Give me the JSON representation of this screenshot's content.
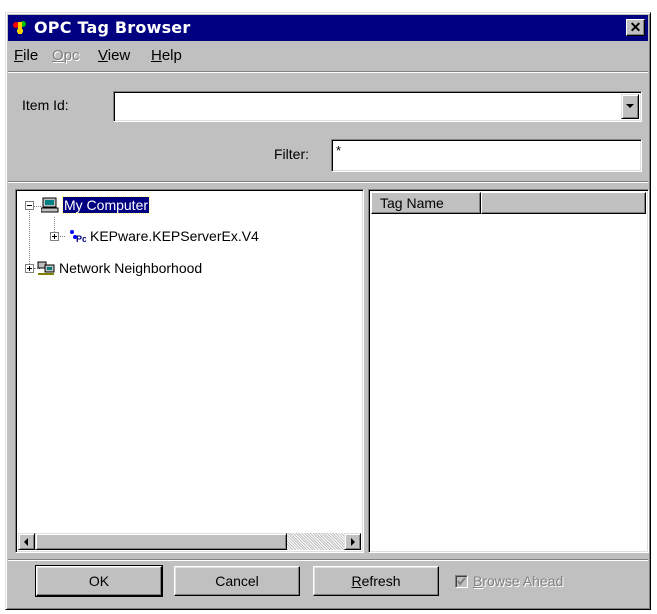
{
  "window": {
    "title": "OPC Tag Browser",
    "close_glyph": "✕",
    "app_icon": "opc-app-icon"
  },
  "menu": {
    "items": [
      {
        "label": "File",
        "accel": "F",
        "rest": "ile",
        "enabled": true
      },
      {
        "label": "Opc",
        "accel": "O",
        "rest": "pc",
        "enabled": false
      },
      {
        "label": "View",
        "accel": "V",
        "rest": "iew",
        "enabled": true
      },
      {
        "label": "Help",
        "accel": "H",
        "rest": "elp",
        "enabled": true
      }
    ]
  },
  "item_id": {
    "label": "Item Id:",
    "value": ""
  },
  "filter": {
    "label": "Filter:",
    "value": "*"
  },
  "tree": {
    "nodes": [
      {
        "label": "My Computer",
        "icon": "computer-icon",
        "expanded": true,
        "selected": true
      },
      {
        "label": "KEPware.KEPServerEx.V4",
        "icon": "opc-server-icon",
        "expanded": false,
        "selected": false
      },
      {
        "label": "Network Neighborhood",
        "icon": "network-icon",
        "expanded": false,
        "selected": false
      }
    ]
  },
  "tag_list": {
    "columns": [
      "Tag Name"
    ]
  },
  "buttons": {
    "ok": "OK",
    "cancel": "Cancel",
    "refresh_accel": "R",
    "refresh_rest": "efresh"
  },
  "browse_ahead": {
    "accel": "B",
    "rest": "rowse Ahead",
    "checked": true,
    "enabled": false
  },
  "colors": {
    "titlebar": "#000080",
    "face": "#c0c0c0",
    "selection": "#000080"
  }
}
